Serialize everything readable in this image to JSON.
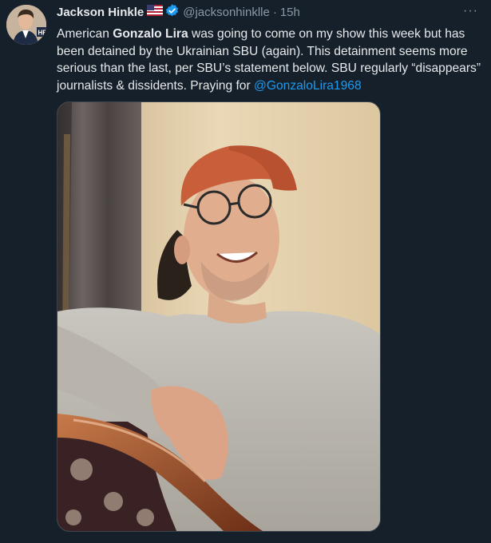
{
  "tweet": {
    "author_name": "Jackson Hinkle",
    "flag_icon": "us-flag-icon",
    "verified_icon": "verified-badge-icon",
    "handle": "@jacksonhinklle",
    "separator": "·",
    "time": "15h",
    "more_label": "···",
    "avatar_badge": "HB",
    "text": {
      "p1": "American ",
      "bold1": "Gonzalo Lira",
      "p2": " was going to come on my show this week but has been detained by the Ukrainian SBU (again). This detainment seems more serious than the last, per SBU’s statement below. SBU regularly “disappears” journalists & dissidents. Praying for ",
      "mention": "@GonzaloLira1968"
    },
    "media": {
      "type": "photo"
    }
  },
  "colors": {
    "background": "#15202b",
    "text": "#e7e9ea",
    "secondary": "#8b98a5",
    "link": "#1d9bf0",
    "verified": "#1d9bf0"
  }
}
